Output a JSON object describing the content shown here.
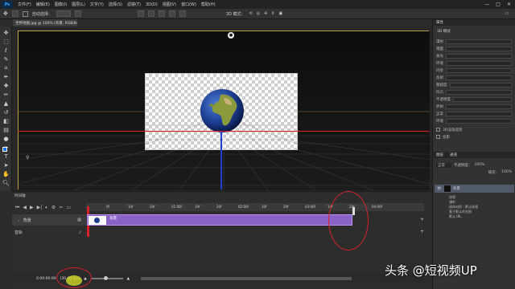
{
  "menu": {
    "app": "Ps",
    "items": [
      "文件(F)",
      "编辑(E)",
      "图像(I)",
      "图层(L)",
      "文字(Y)",
      "选择(S)",
      "滤镜(T)",
      "3D(D)",
      "视图(V)",
      "窗口(W)",
      "帮助(H)"
    ],
    "window_buttons": [
      "—",
      "□",
      "✕"
    ]
  },
  "options": {
    "auto_select": "自动选择：",
    "mode_3d": "3D 模式："
  },
  "document": {
    "tab": "世界地图.jpg @ 100% (背景, RGB/8#) *"
  },
  "timeline": {
    "title": "时间轴",
    "ruler_ticks": [
      "0f",
      "10f",
      "20f",
      "01:00f",
      "10f",
      "20f",
      "02:00f",
      "10f",
      "20f",
      "03:00f",
      "10f",
      "20f",
      "04:00f"
    ],
    "track1_label": "背景",
    "clip_label": "背景",
    "track2_label": "音轨",
    "current_time": "0:00:00:00",
    "fps": "(30.00 fps)"
  },
  "right_panel": {
    "panel_title": "属性",
    "section": "3D 模式",
    "rows": [
      "漫射",
      "镜面",
      "发光",
      "环境",
      "闪亮",
      "反射",
      "粗糙度",
      "凹凸",
      "不透明度",
      "折射",
      "正常",
      "环境"
    ],
    "checkbox1": "3D渲染选项",
    "checkbox2": "投影",
    "layers_tab": "图层",
    "channels_tab": "通道",
    "blend_mode": "正常",
    "opacity_label": "不透明度：",
    "opacity_value": "100%",
    "fill_label": "填充：",
    "fill_value": "100%",
    "layer_name": "背景",
    "sublayers": [
      "纹理",
      "漫射",
      "球体材质 - 默认纹理",
      "基于默认的光照",
      "默认 IBL"
    ]
  },
  "watermark": "头条 @短视频UP"
}
